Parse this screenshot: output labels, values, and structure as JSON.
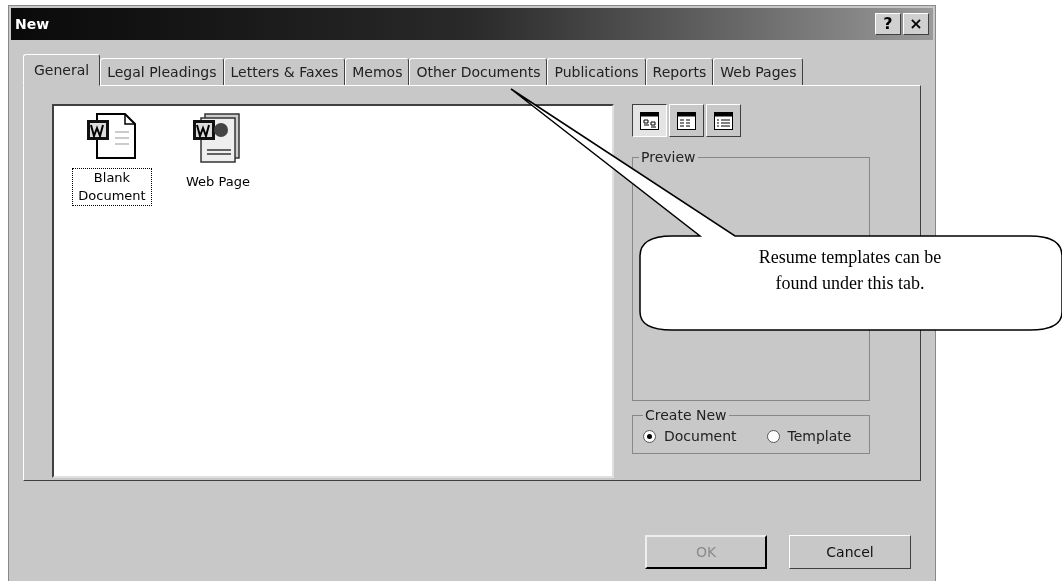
{
  "window": {
    "title": "New",
    "title_buttons": [
      "?",
      "×"
    ]
  },
  "tabs": [
    {
      "label": "General",
      "selected": true
    },
    {
      "label": "Legal Pleadings",
      "selected": false
    },
    {
      "label": "Letters & Faxes",
      "selected": false
    },
    {
      "label": "Memos",
      "selected": false
    },
    {
      "label": "Other Documents",
      "selected": false
    },
    {
      "label": "Publications",
      "selected": false
    },
    {
      "label": "Reports",
      "selected": false
    },
    {
      "label": "Web Pages",
      "selected": false
    }
  ],
  "templates": [
    {
      "label": "Blank Document",
      "kind": "blank",
      "selected": true
    },
    {
      "label": "Web Page",
      "kind": "web",
      "selected": false
    }
  ],
  "view_buttons": [
    {
      "kind": "large",
      "selected": true
    },
    {
      "kind": "list",
      "selected": false
    },
    {
      "kind": "details",
      "selected": false
    }
  ],
  "preview": {
    "label": "Preview"
  },
  "create_new": {
    "label": "Create New",
    "options": [
      {
        "label": "Document",
        "selected": true
      },
      {
        "label": "Template",
        "selected": false
      }
    ]
  },
  "buttons": [
    {
      "label": "OK",
      "disabled": true
    },
    {
      "label": "Cancel",
      "disabled": false
    }
  ],
  "callout": {
    "text": "Resume templates can be found under this tab."
  }
}
